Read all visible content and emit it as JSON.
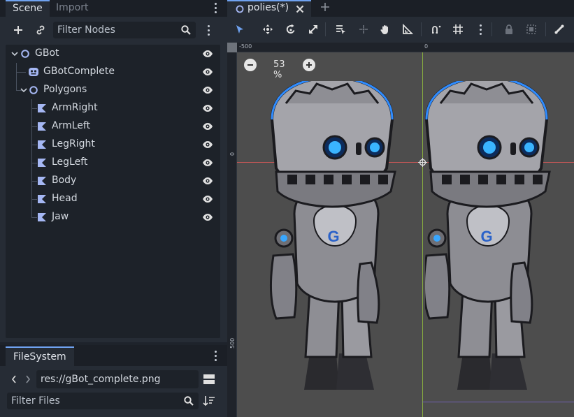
{
  "scene_dock": {
    "tabs": [
      "Scene",
      "Import"
    ]
  },
  "scene_toolbar": {
    "filter_placeholder": "Filter Nodes"
  },
  "tree": [
    {
      "name": "GBot",
      "depth": 0,
      "type": "node2d",
      "expanded": true,
      "visible": true
    },
    {
      "name": "GBotComplete",
      "depth": 1,
      "type": "sprite",
      "visible": true
    },
    {
      "name": "Polygons",
      "depth": 1,
      "type": "node2d",
      "expanded": true,
      "visible": true
    },
    {
      "name": "ArmRight",
      "depth": 2,
      "type": "polygon2d",
      "visible": true
    },
    {
      "name": "ArmLeft",
      "depth": 2,
      "type": "polygon2d",
      "visible": true
    },
    {
      "name": "LegRight",
      "depth": 2,
      "type": "polygon2d",
      "visible": true
    },
    {
      "name": "LegLeft",
      "depth": 2,
      "type": "polygon2d",
      "visible": true
    },
    {
      "name": "Body",
      "depth": 2,
      "type": "polygon2d",
      "visible": true
    },
    {
      "name": "Head",
      "depth": 2,
      "type": "polygon2d",
      "visible": true
    },
    {
      "name": "Jaw",
      "depth": 2,
      "type": "polygon2d",
      "visible": true
    }
  ],
  "filesystem": {
    "tab": "FileSystem",
    "path": "res://gBot_complete.png",
    "filter_placeholder": "Filter Files"
  },
  "document_tab": {
    "title": "polies(*)"
  },
  "viewport": {
    "zoom": "53 %",
    "ruler_top": [
      "-500",
      "0"
    ],
    "ruler_left": [
      "0",
      "500"
    ]
  },
  "colors": {
    "accent": "#6fa2f0",
    "node2d_icon": "#a5b7f3",
    "polygon_icon": "#a5b7f3",
    "x_axis": "#ea5a5a",
    "y_axis": "#96c43c",
    "canvas": "#4d4d4d"
  }
}
